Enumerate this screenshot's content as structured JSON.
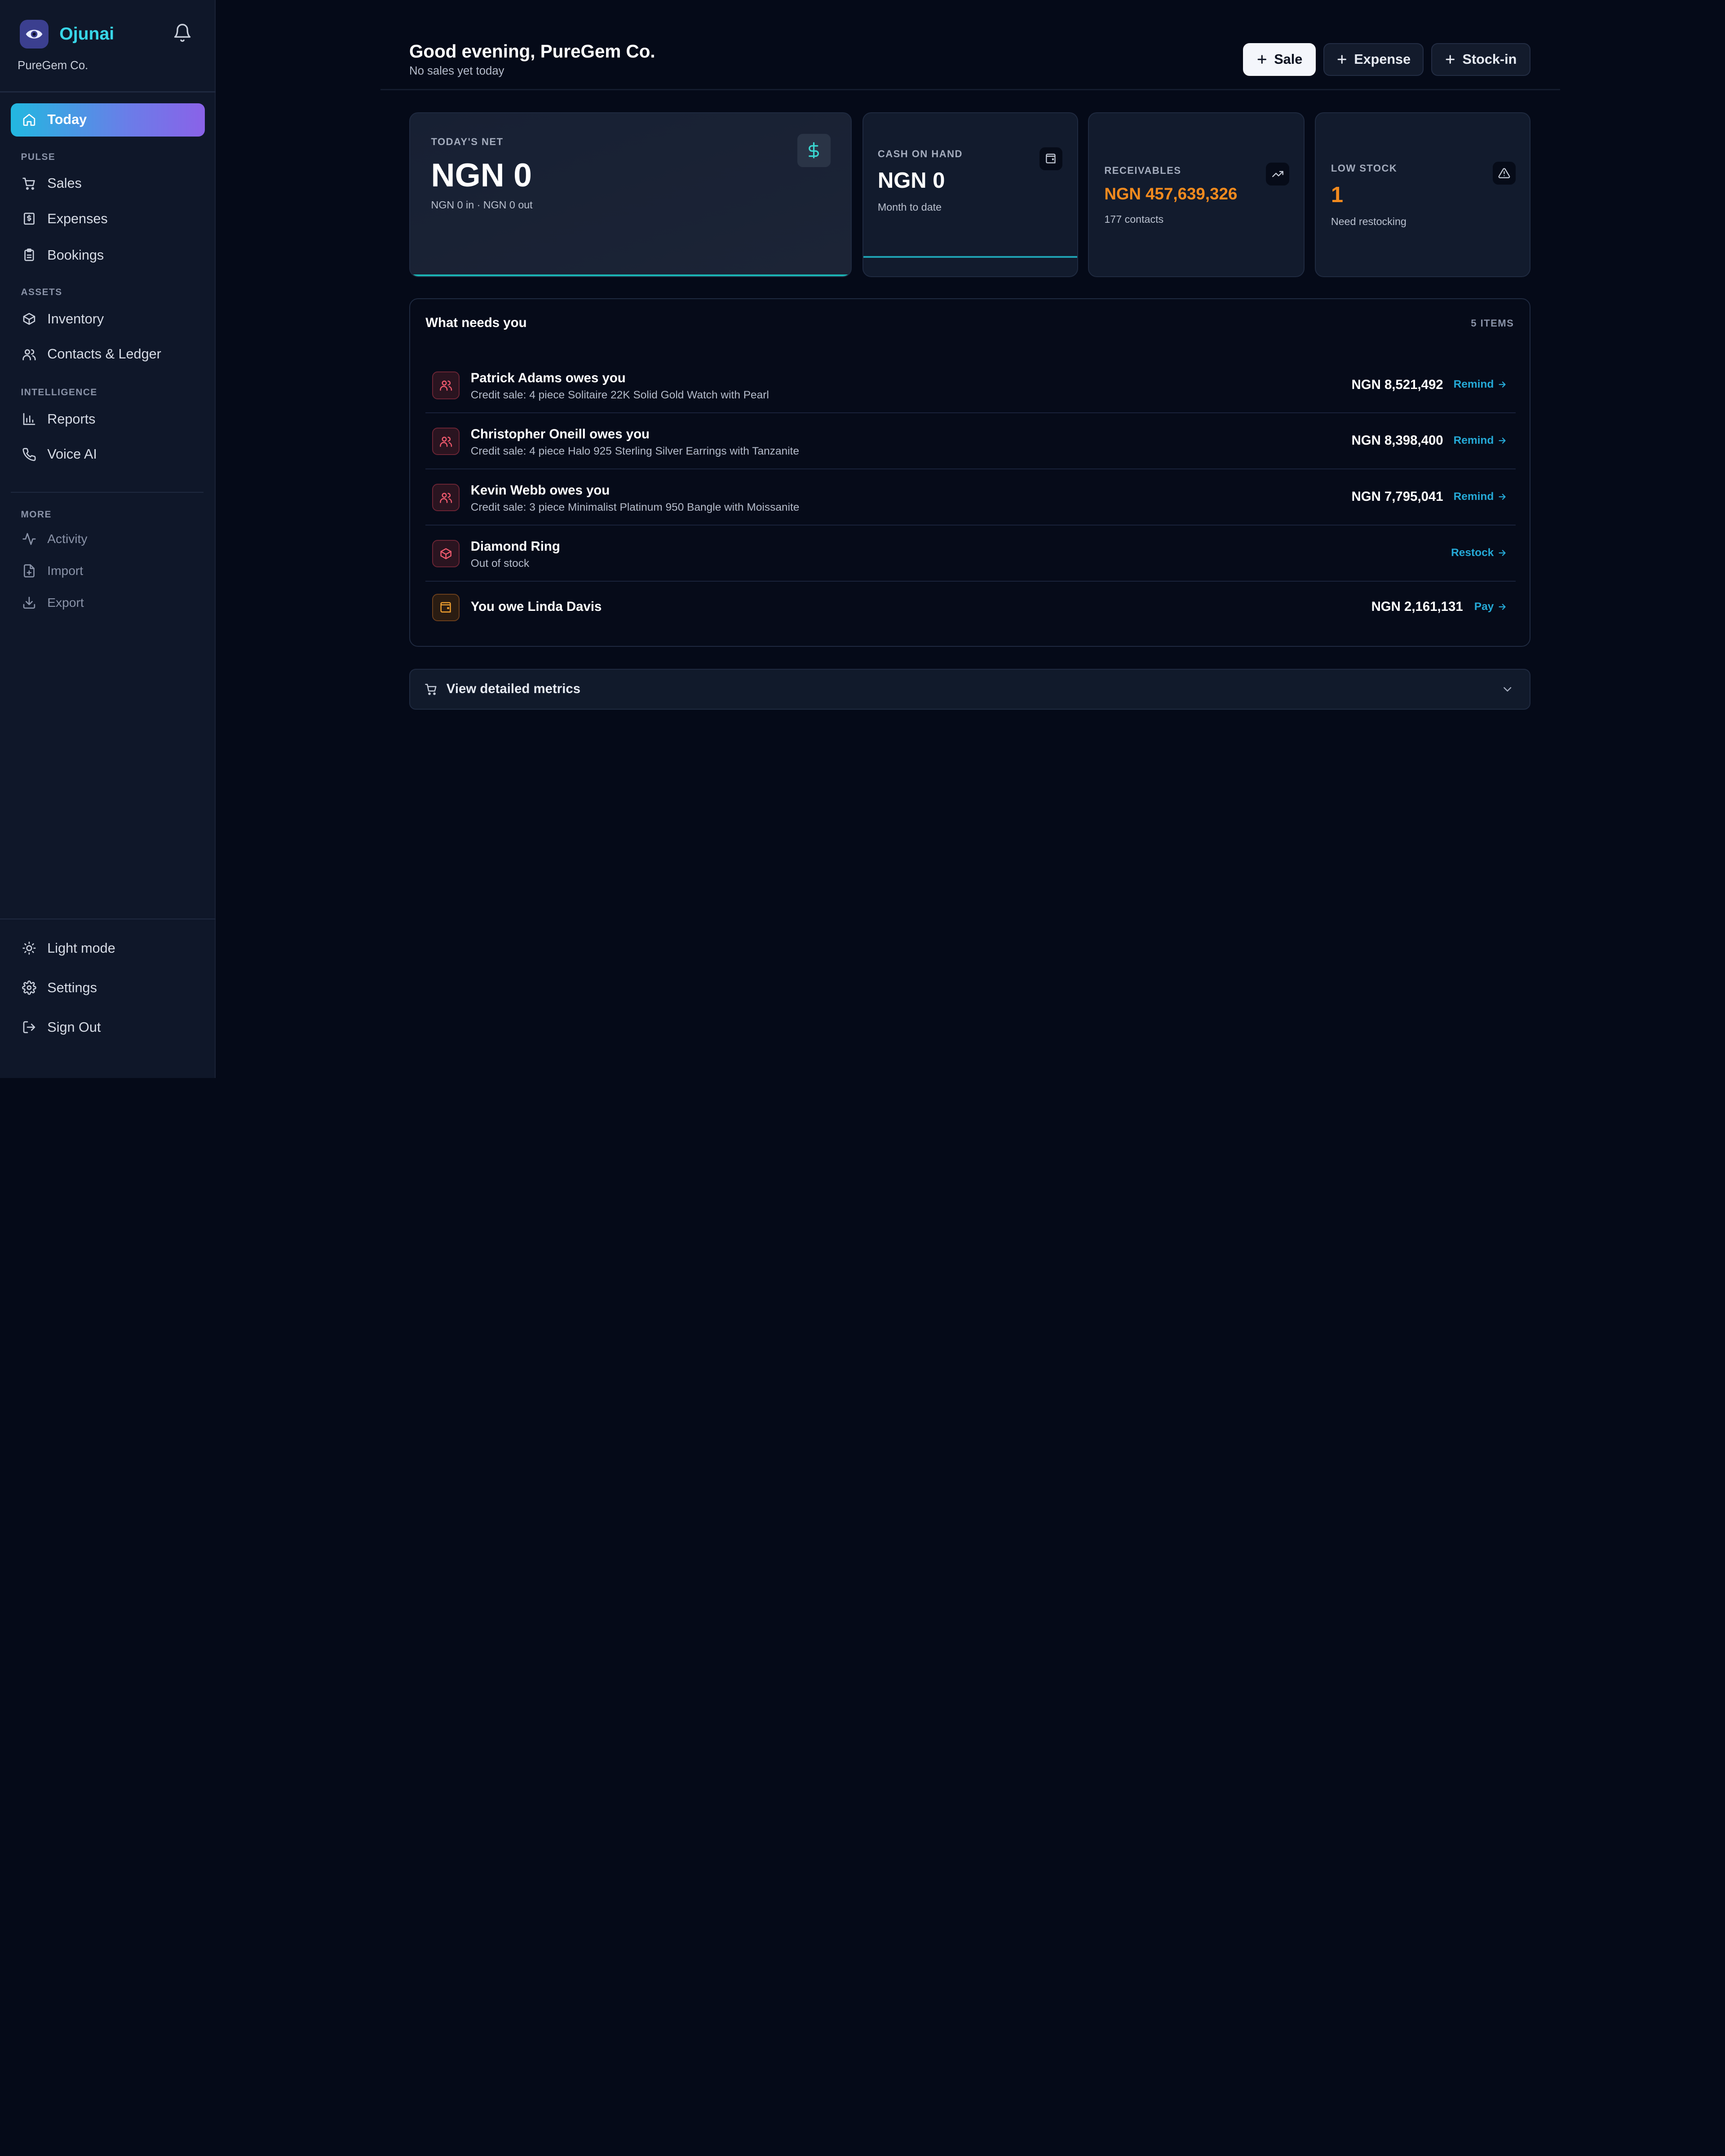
{
  "app": {
    "name": "Ojunai",
    "org": "PureGem Co."
  },
  "sidebar": {
    "today": "Today",
    "sections": {
      "pulse": "PULSE",
      "assets": "ASSETS",
      "intelligence": "INTELLIGENCE",
      "more": "MORE"
    },
    "sales": "Sales",
    "expenses": "Expenses",
    "bookings": "Bookings",
    "inventory": "Inventory",
    "contacts": "Contacts & Ledger",
    "reports": "Reports",
    "voice_ai": "Voice AI",
    "activity": "Activity",
    "import": "Import",
    "export": "Export",
    "light_mode": "Light mode",
    "settings": "Settings",
    "sign_out": "Sign Out"
  },
  "header": {
    "greeting": "Good evening, PureGem Co.",
    "subtitle": "No sales yet today",
    "buttons": {
      "sale": "Sale",
      "expense": "Expense",
      "stock_in": "Stock-in"
    }
  },
  "stats": {
    "todays_net": {
      "label": "TODAY'S NET",
      "value": "NGN 0",
      "note": "NGN 0 in · NGN 0 out"
    },
    "cash_on_hand": {
      "label": "CASH ON HAND",
      "value": "NGN 0",
      "note": "Month to date"
    },
    "receivables": {
      "label": "RECEIVABLES",
      "value": "NGN 457,639,326",
      "note": "177 contacts",
      "color": "#f28a1e"
    },
    "low_stock": {
      "label": "LOW STOCK",
      "value": "1",
      "note": "Need restocking",
      "color": "#f28a1e"
    }
  },
  "needs": {
    "title": "What needs you",
    "count": "5 ITEMS",
    "items": [
      {
        "title": "Patrick Adams owes you",
        "subtitle": "Credit sale: 4 piece Solitaire 22K Solid Gold Watch with Pearl",
        "amount": "NGN 8,521,492",
        "action": "Remind",
        "icon": "users-icon"
      },
      {
        "title": "Christopher Oneill owes you",
        "subtitle": "Credit sale: 4 piece Halo 925 Sterling Silver Earrings with Tanzanite",
        "amount": "NGN 8,398,400",
        "action": "Remind",
        "icon": "users-icon"
      },
      {
        "title": "Kevin Webb owes you",
        "subtitle": "Credit sale: 3 piece Minimalist Platinum 950 Bangle with Moissanite",
        "amount": "NGN 7,795,041",
        "action": "Remind",
        "icon": "users-icon"
      },
      {
        "title": "Diamond Ring",
        "subtitle": "Out of stock",
        "amount": "",
        "action": "Restock",
        "icon": "box-icon"
      },
      {
        "title": "You owe Linda Davis",
        "subtitle": "",
        "amount": "NGN 2,161,131",
        "action": "Pay",
        "icon": "wallet-icon"
      }
    ]
  },
  "metrics": {
    "label": "View detailed metrics"
  }
}
